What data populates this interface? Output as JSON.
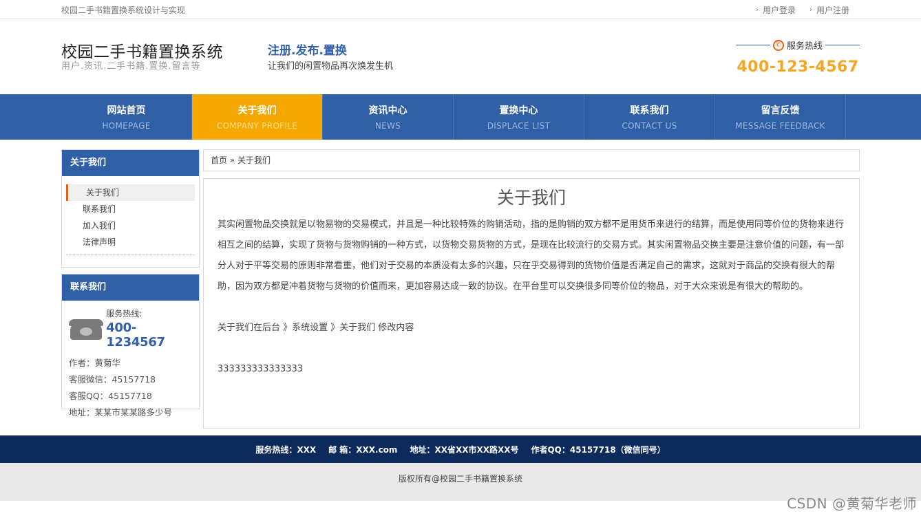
{
  "topbar": {
    "site_subtitle": "校园二手书籍置换系统设计与实现",
    "links": [
      "用户登录",
      "用户注册"
    ]
  },
  "header": {
    "brand_title": "校园二手书籍置换系统",
    "brand_sub": "用户.资讯.二手书籍.置换.留言等",
    "slogan_title": "注册.发布.置换",
    "slogan_sub": "让我们的闲置物品再次焕发生机",
    "hotline_label": "服务热线",
    "hotline_number": "400-123-4567"
  },
  "nav": [
    {
      "cn": "网站首页",
      "en": "HOMEPAGE",
      "active": false
    },
    {
      "cn": "关于我们",
      "en": "COMPANY PROFILE",
      "active": true
    },
    {
      "cn": "资讯中心",
      "en": "NEWS",
      "active": false
    },
    {
      "cn": "置换中心",
      "en": "DISPLACE LIST",
      "active": false
    },
    {
      "cn": "联系我们",
      "en": "CONTACT US",
      "active": false
    },
    {
      "cn": "留言反馈",
      "en": "MESSAGE FEEDBACK",
      "active": false
    }
  ],
  "sidebar": {
    "about_title": "关于我们",
    "about_items": [
      "关于我们",
      "联系我们",
      "加入我们",
      "法律声明"
    ],
    "contact_title": "联系我们",
    "phone_label": "服务热线:",
    "phone_number": "400-1234567",
    "author": "作者：黄菊华",
    "wechat": "客服微信：45157718",
    "qq": "客服QQ：45157718",
    "address": "地址：某某市某某路多少号"
  },
  "breadcrumb": {
    "home": "首页",
    "sep": "»",
    "current": "关于我们"
  },
  "content": {
    "title": "关于我们",
    "paragraph": "其实闲置物品交换就是以物易物的交易模式，并且是一种比较特殊的购销活动，指的是购销的双方都不是用货币来进行的结算，而是使用同等价位的货物来进行相互之间的结算，实现了货物与货物购销的一种方式，以货物交易货物的方式，是现在比较流行的交易方式。其实闲置物品交换主要是注意价值的问题，有一部分人对于平等交易的原则非常看重，他们对于交易的本质没有太多的兴趣，只在乎交易得到的货物价值是否满足自己的需求，这就对于商品的交换有很大的帮助，因为双方都是冲着货物与货物的价值而来，更加容易达成一致的协议。在平台里可以交换很多同等价位的物品，对于大众来说是有很大的帮助的。",
    "note": "关于我们在后台 》系统设置 》关于我们 修改内容",
    "extra": "333333333333333"
  },
  "footer": {
    "hotline": "服务热线：XXX",
    "email": "邮 箱：XXX.com",
    "address": "地址：XX省XX市XX路XX号",
    "qq": "作者QQ：45157718（微信同号）",
    "copyright": "版权所有@校园二手书籍置换系统"
  },
  "watermark": "CSDN @黄菊华老师",
  "colors": {
    "primary": "#2f5fa7",
    "accent": "#f5a800",
    "footer": "#0c2a5c"
  }
}
